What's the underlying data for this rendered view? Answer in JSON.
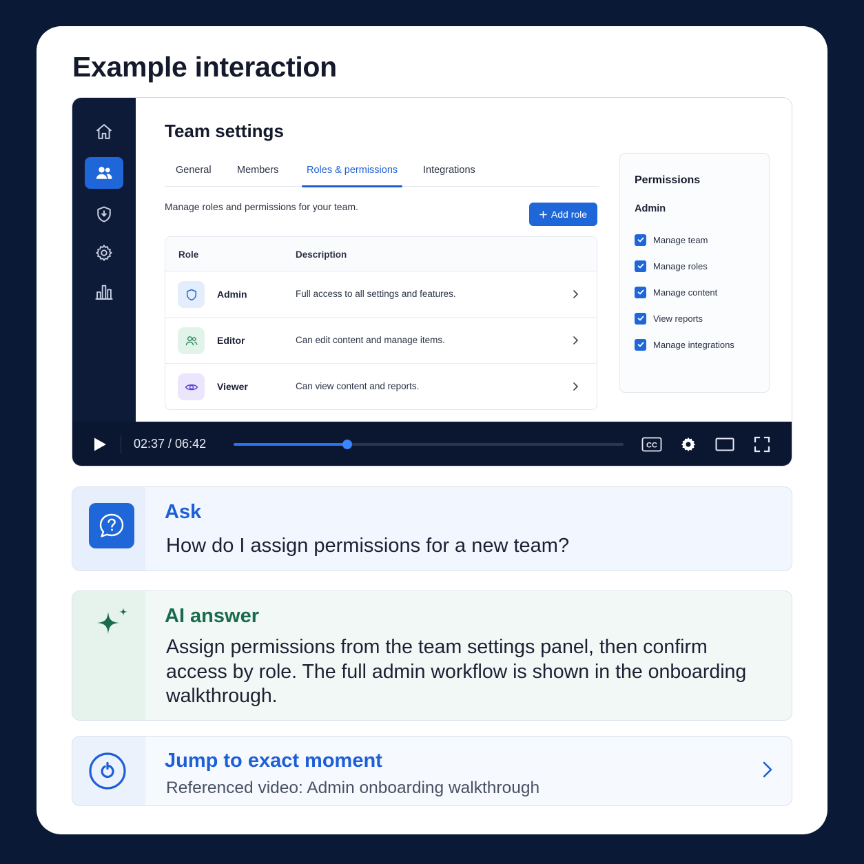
{
  "page": {
    "title": "Example interaction"
  },
  "video": {
    "sidebar": {
      "items": [
        {
          "icon": "home-icon",
          "active": false
        },
        {
          "icon": "users-icon",
          "active": true
        },
        {
          "icon": "shield-icon",
          "active": false
        },
        {
          "icon": "gear-icon",
          "active": false
        },
        {
          "icon": "bar-chart-icon",
          "active": false
        }
      ]
    },
    "app": {
      "title": "Team settings",
      "tabs": [
        {
          "label": "General",
          "active": false
        },
        {
          "label": "Members",
          "active": false
        },
        {
          "label": "Roles & permissions",
          "active": true
        },
        {
          "label": "Integrations",
          "active": false
        }
      ],
      "subtitle": "Manage roles and permissions for your team.",
      "add_role_label": "Add role",
      "table": {
        "headers": [
          "Role",
          "Description"
        ],
        "rows": [
          {
            "role": "Admin",
            "description": "Full access to all settings and features.",
            "icon": "shield-icon",
            "icon_color": "#1f66d8"
          },
          {
            "role": "Editor",
            "description": "Can edit content and manage items.",
            "icon": "users-icon",
            "icon_color": "#2f8a5f"
          },
          {
            "role": "Viewer",
            "description": "Can view content and reports.",
            "icon": "eye-icon",
            "icon_color": "#5b3fd6"
          }
        ]
      },
      "permissions": {
        "title": "Permissions",
        "role": "Admin",
        "items": [
          {
            "label": "Manage team",
            "checked": true
          },
          {
            "label": "Manage roles",
            "checked": true
          },
          {
            "label": "Manage content",
            "checked": true
          },
          {
            "label": "View reports",
            "checked": true
          },
          {
            "label": "Manage integrations",
            "checked": true
          }
        ]
      }
    },
    "player": {
      "time": "02:37 / 06:42",
      "progress": 0.291,
      "cc_label": "CC"
    }
  },
  "ask": {
    "heading": "Ask",
    "question": "How do I assign permissions for a new team?"
  },
  "answer": {
    "heading": "AI answer",
    "text": "Assign permissions from the team settings panel, then confirm access by role. The full admin workflow is shown in the onboarding walkthrough."
  },
  "jump": {
    "heading": "Jump to exact moment",
    "reference": "Referenced video: Admin onboarding walkthrough"
  },
  "colors": {
    "accent": "#1f66d8",
    "sidebar_bg": "#0e1b38",
    "answer_green": "#1a6b4d",
    "background": "#0a1a36"
  }
}
